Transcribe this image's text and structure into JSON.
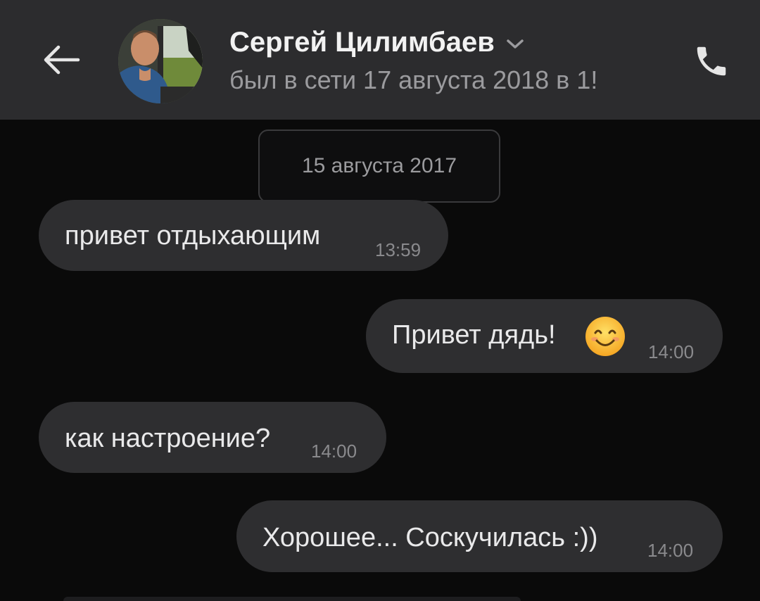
{
  "header": {
    "contact_name": "Сергей Цилимбаев",
    "last_seen": "был в сети 17 августа 2018 в 1!",
    "back_icon": "arrow-left-icon",
    "call_icon": "phone-icon",
    "chevron_icon": "chevron-down-icon"
  },
  "chat": {
    "date_separator": "15 августа 2017",
    "messages": [
      {
        "direction": "incoming",
        "text": "привет отдыхающим",
        "time": "13:59"
      },
      {
        "direction": "outgoing",
        "text": "Привет дядь!",
        "emoji": "smiling-face-emoji",
        "time": "14:00"
      },
      {
        "direction": "incoming",
        "text": "как настроение?",
        "time": "14:00"
      },
      {
        "direction": "outgoing",
        "text": "Хорошее... Соскучилась :))",
        "time": "14:00"
      }
    ]
  },
  "colors": {
    "background": "#0a0a0a",
    "header": "#2c2c2e",
    "bubble": "#2e2e30",
    "text_primary": "#e9e9ea",
    "text_secondary": "#9b9b9e"
  }
}
